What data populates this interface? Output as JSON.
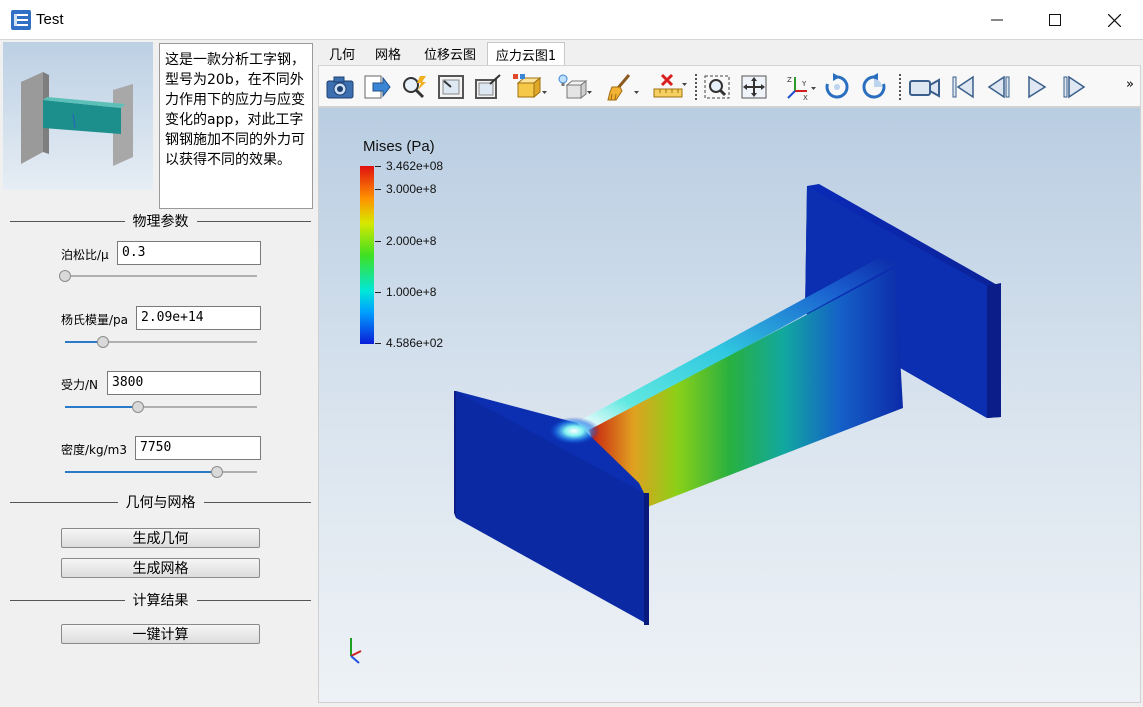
{
  "window": {
    "title": "Test"
  },
  "description": "这是一款分析工字钢，型号为20b，在不同外力作用下的应力与应变变化的app，对此工字钢钢施加不同的外力可以获得不同的效果。",
  "physics": {
    "title": "物理参数",
    "params": [
      {
        "label": "泊松比/μ",
        "value": "0.3",
        "slider_fraction": 0.0
      },
      {
        "label": "杨氏模量/pa",
        "value": "2.09e+14",
        "slider_fraction": 0.2
      },
      {
        "label": "受力/N",
        "value": "3800",
        "slider_fraction": 0.38
      },
      {
        "label": "密度/kg/m3",
        "value": "7750",
        "slider_fraction": 0.79
      }
    ]
  },
  "geometry": {
    "title": "几何与网格",
    "gen_geom_label": "生成几何",
    "gen_mesh_label": "生成网格"
  },
  "results": {
    "title": "计算结果",
    "compute_label": "一键计算"
  },
  "tabs": [
    "几何",
    "网格",
    "位移云图",
    "应力云图1"
  ],
  "active_tab": "应力云图1",
  "toolbar": {
    "icons": [
      "camera-icon",
      "export-icon",
      "zoom-select-icon",
      "fit-view-icon",
      "fit-box-icon",
      "display-mode-icon",
      "lighting-icon",
      "clear-brush-icon",
      "delete-ruler-icon",
      "zoom-box-icon",
      "pan-icon",
      "axes-icon",
      "rotate-cw-icon",
      "rotate-ccw-icon",
      "video-camera-icon",
      "first-frame-icon",
      "prev-frame-icon",
      "play-icon",
      "next-frame-icon"
    ],
    "overflow": "»"
  },
  "legend": {
    "title": "Mises (Pa)",
    "max": "3.462e+08",
    "ticks": [
      "3.000e+8",
      "2.000e+8",
      "1.000e+8"
    ],
    "min": "4.586e+02",
    "colors": [
      "#0a1ed8",
      "#00a0ff",
      "#00e8d8",
      "#40e020",
      "#d8e800",
      "#ff9000",
      "#e01010"
    ]
  }
}
